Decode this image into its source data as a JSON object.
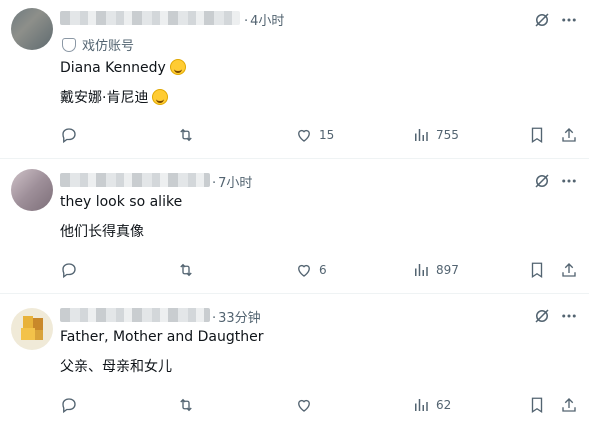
{
  "replies": [
    {
      "handle_blurred": true,
      "time": "4小时",
      "badge_label": "戏仿账号",
      "lines": [
        "Diana Kennedy",
        "戴安娜·肯尼迪"
      ],
      "actions": {
        "reply": "",
        "repost": "",
        "likes": "15",
        "views": "755"
      }
    },
    {
      "handle_blurred": true,
      "time": "7小时",
      "lines": [
        "they look so alike",
        "他们长得真像"
      ],
      "actions": {
        "reply": "",
        "repost": "",
        "likes": "6",
        "views": "897"
      }
    },
    {
      "handle_blurred": true,
      "time": "33分钟",
      "lines": [
        "Father, Mother and Daugther",
        "父亲、母亲和女儿"
      ],
      "actions": {
        "reply": "",
        "repost": "",
        "likes": "",
        "views": "62"
      }
    }
  ],
  "icons": [
    "reply-icon",
    "repost-icon",
    "like-icon",
    "views-icon",
    "bookmark-icon",
    "share-icon",
    "grok-icon",
    "more-icon"
  ],
  "colors": {
    "text": "#0f1419",
    "secondary": "#536471",
    "divider": "#eff3f4"
  }
}
